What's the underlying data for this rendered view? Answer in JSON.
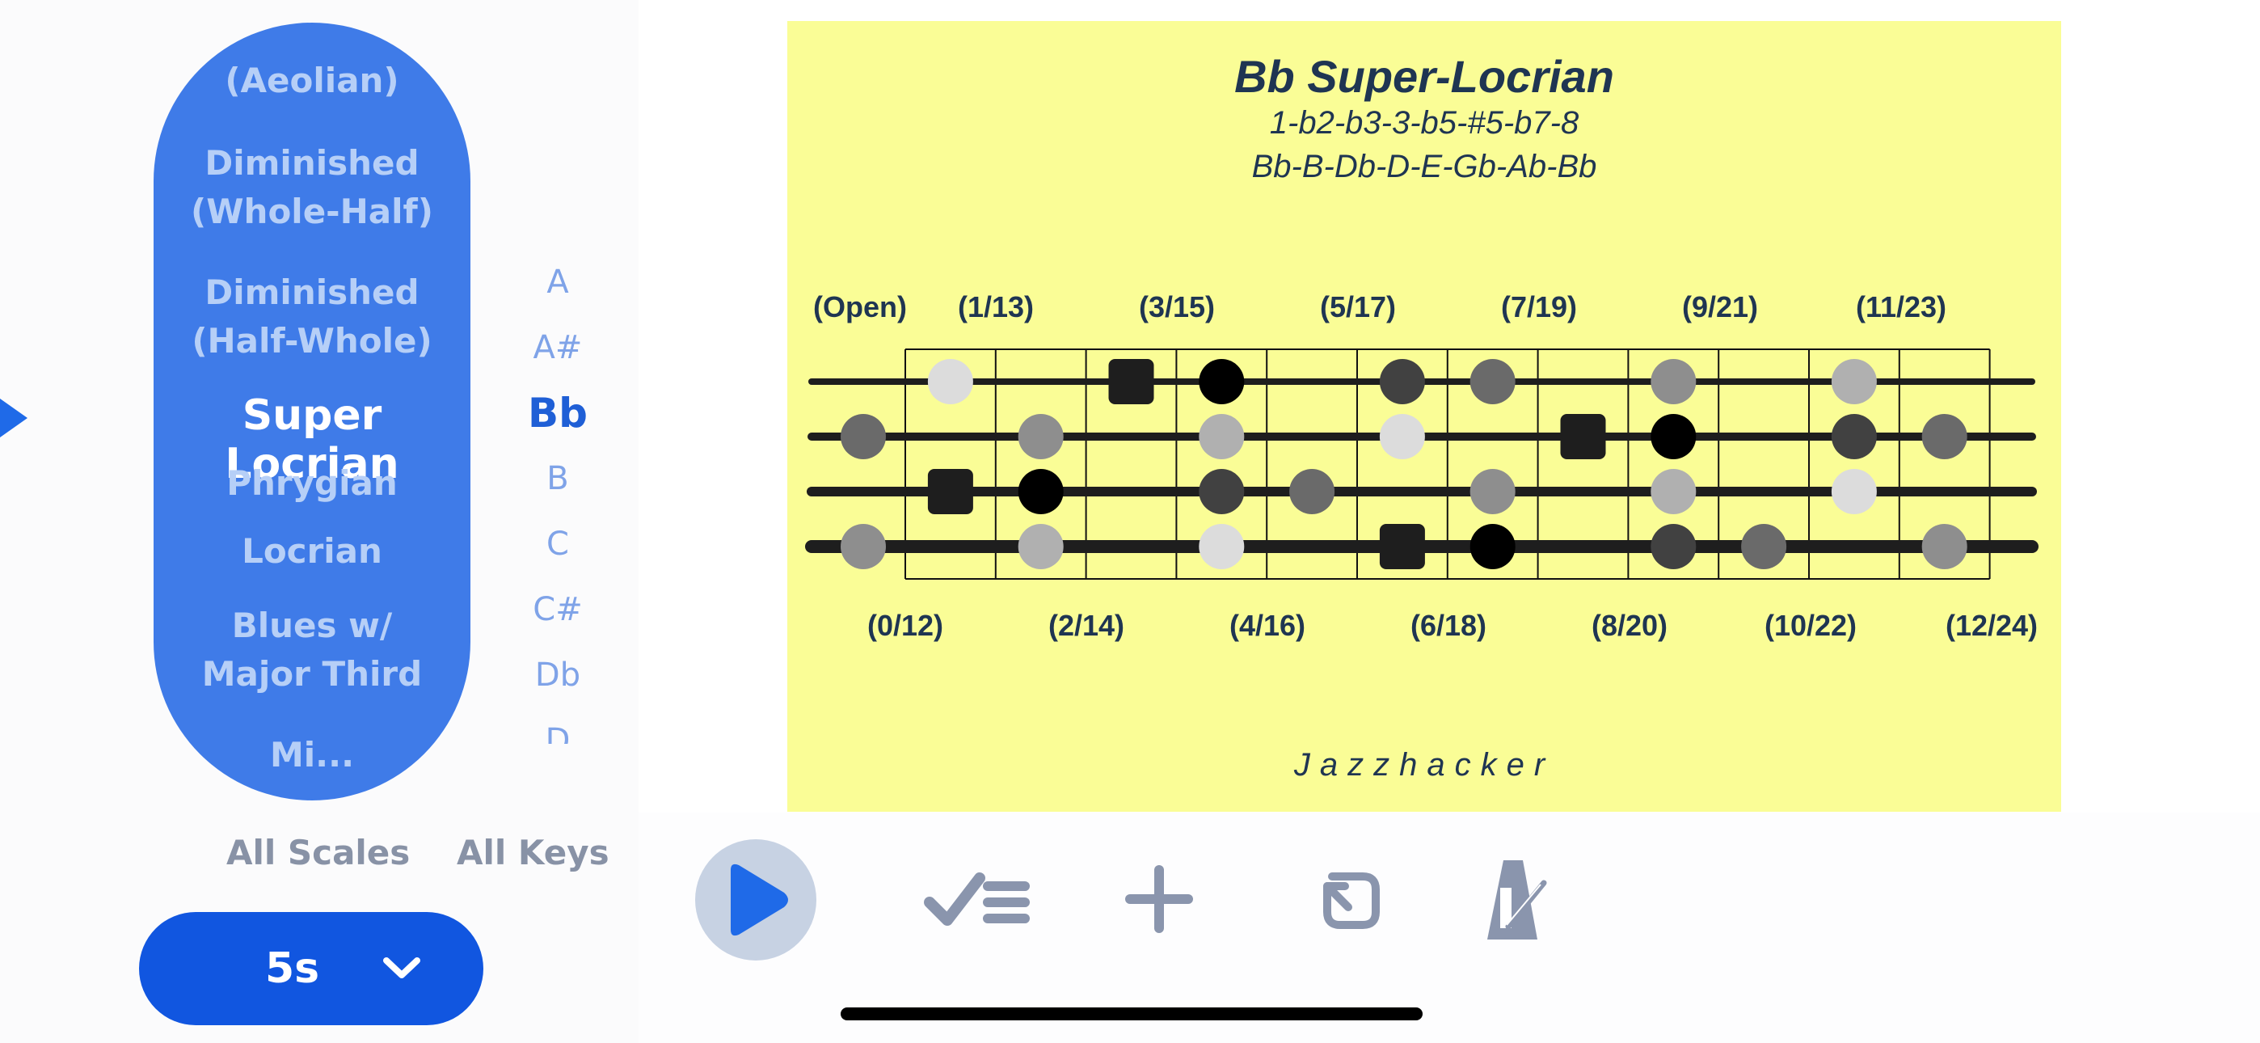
{
  "scale_picker": {
    "items": [
      {
        "label": "(Aeolian)",
        "offset": -232
      },
      {
        "label": "Diminished\n(Whole-Half)",
        "offset": -160
      },
      {
        "label": "Diminished\n(Half-Whole)",
        "offset": 0
      },
      {
        "label": "Super Locrian",
        "offset": 0
      },
      {
        "label": "Phrygian",
        "offset": 0
      },
      {
        "label": "Locrian",
        "offset": 0
      },
      {
        "label": "Blues w/\nMajor Third",
        "offset": 0
      },
      {
        "label": "Mi...",
        "offset": 0
      }
    ],
    "selected": "Super Locrian"
  },
  "key_picker": {
    "items": [
      "A",
      "A#",
      "Bb",
      "B",
      "C",
      "C#",
      "Db",
      "D"
    ],
    "selected": "Bb"
  },
  "tabs": {
    "all_scales": "All Scales",
    "all_keys": "All Keys"
  },
  "timer": {
    "label": "5s",
    "icon": "chevron-down-icon"
  },
  "card": {
    "title": "Bb Super-Locrian",
    "formula": "1-b2-b3-3-b5-#5-b7-8",
    "notes": "Bb-B-Db-D-E-Gb-Ab-Bb",
    "brand": "Jazzhacker",
    "top_fret_labels": [
      "(Open)",
      "(1/13)",
      "(3/15)",
      "(5/17)",
      "(7/19)",
      "(9/21)",
      "(11/23)"
    ],
    "bottom_fret_labels": [
      "(0/12)",
      "(2/14)",
      "(4/16)",
      "(6/18)",
      "(8/20)",
      "(10/22)",
      "(12/24)"
    ],
    "notes_on_fretboard": [
      {
        "string": 1,
        "fret": 1,
        "shade": "white"
      },
      {
        "string": 1,
        "fret": 3,
        "shade": "root"
      },
      {
        "string": 1,
        "fret": 4,
        "shade": "black"
      },
      {
        "string": 1,
        "fret": 6,
        "shade": "dark"
      },
      {
        "string": 1,
        "fret": 7,
        "shade": "mid"
      },
      {
        "string": 1,
        "fret": 9,
        "shade": "gray"
      },
      {
        "string": 1,
        "fret": 11,
        "shade": "light"
      },
      {
        "string": 2,
        "fret": 0,
        "shade": "mid"
      },
      {
        "string": 2,
        "fret": 2,
        "shade": "gray"
      },
      {
        "string": 2,
        "fret": 4,
        "shade": "light"
      },
      {
        "string": 2,
        "fret": 6,
        "shade": "white"
      },
      {
        "string": 2,
        "fret": 8,
        "shade": "root"
      },
      {
        "string": 2,
        "fret": 9,
        "shade": "black"
      },
      {
        "string": 2,
        "fret": 11,
        "shade": "dark"
      },
      {
        "string": 2,
        "fret": 12,
        "shade": "mid"
      },
      {
        "string": 3,
        "fret": 1,
        "shade": "root"
      },
      {
        "string": 3,
        "fret": 2,
        "shade": "black"
      },
      {
        "string": 3,
        "fret": 4,
        "shade": "dark"
      },
      {
        "string": 3,
        "fret": 5,
        "shade": "mid"
      },
      {
        "string": 3,
        "fret": 7,
        "shade": "gray"
      },
      {
        "string": 3,
        "fret": 9,
        "shade": "light"
      },
      {
        "string": 3,
        "fret": 11,
        "shade": "white"
      },
      {
        "string": 4,
        "fret": 0,
        "shade": "gray"
      },
      {
        "string": 4,
        "fret": 2,
        "shade": "light"
      },
      {
        "string": 4,
        "fret": 4,
        "shade": "white"
      },
      {
        "string": 4,
        "fret": 6,
        "shade": "root"
      },
      {
        "string": 4,
        "fret": 7,
        "shade": "black"
      },
      {
        "string": 4,
        "fret": 9,
        "shade": "dark"
      },
      {
        "string": 4,
        "fret": 10,
        "shade": "mid"
      },
      {
        "string": 4,
        "fret": 12,
        "shade": "gray"
      }
    ]
  },
  "controls": [
    {
      "name": "play-button",
      "icon": "play-icon"
    },
    {
      "name": "checklist-button",
      "icon": "checklist-icon"
    },
    {
      "name": "add-button",
      "icon": "plus-icon"
    },
    {
      "name": "repeat-button",
      "icon": "repeat-icon"
    },
    {
      "name": "metronome-button",
      "icon": "metronome-icon"
    }
  ],
  "colors": {
    "accent": "#1156e0",
    "picker_bg": "#3f7be8",
    "card_bg": "#fafd96",
    "control_icon": "#8a95ad",
    "play_icon": "#1f6ae8"
  }
}
